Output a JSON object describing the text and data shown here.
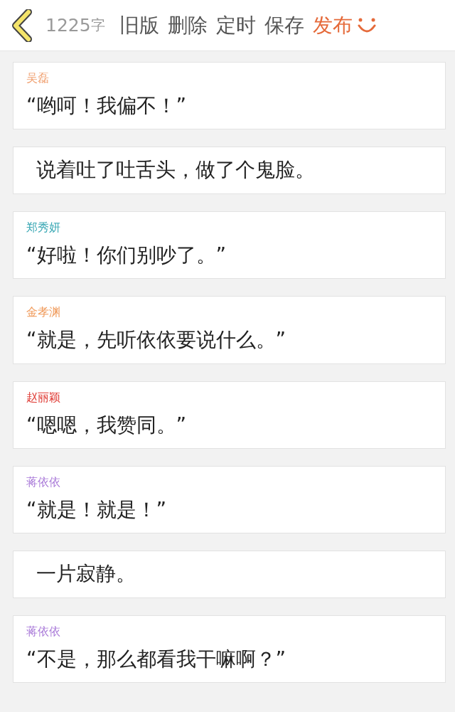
{
  "header": {
    "word_count": "1225",
    "word_unit": "字",
    "actions": [
      {
        "label": "旧版",
        "kind": "plain"
      },
      {
        "label": "删除",
        "kind": "plain"
      },
      {
        "label": "定时",
        "kind": "plain"
      },
      {
        "label": "保存",
        "kind": "plain"
      },
      {
        "label": "发布",
        "kind": "primary"
      }
    ]
  },
  "entries": [
    {
      "kind": "dialogue",
      "speaker": "吴磊",
      "color": "#f0a070",
      "text": "“哟呵！我偏不！”"
    },
    {
      "kind": "narration",
      "text": "说着吐了吐舌头，做了个鬼脸。"
    },
    {
      "kind": "dialogue",
      "speaker": "郑秀妍",
      "color": "#3aa8b4",
      "text": "“好啦！你们别吵了。”"
    },
    {
      "kind": "dialogue",
      "speaker": "金孝渊",
      "color": "#f09a5a",
      "text": "“就是，先听依依要说什么。”"
    },
    {
      "kind": "dialogue",
      "speaker": "赵丽颖",
      "color": "#e0403a",
      "text": "“嗯嗯，我赞同。”"
    },
    {
      "kind": "dialogue",
      "speaker": "蒋依依",
      "color": "#a878d8",
      "text": "“就是！就是！”"
    },
    {
      "kind": "narration",
      "text": "一片寂静。"
    },
    {
      "kind": "dialogue",
      "speaker": "蒋依依",
      "color": "#a878d8",
      "text": "“不是，那么都看我干嘛啊？”"
    }
  ]
}
